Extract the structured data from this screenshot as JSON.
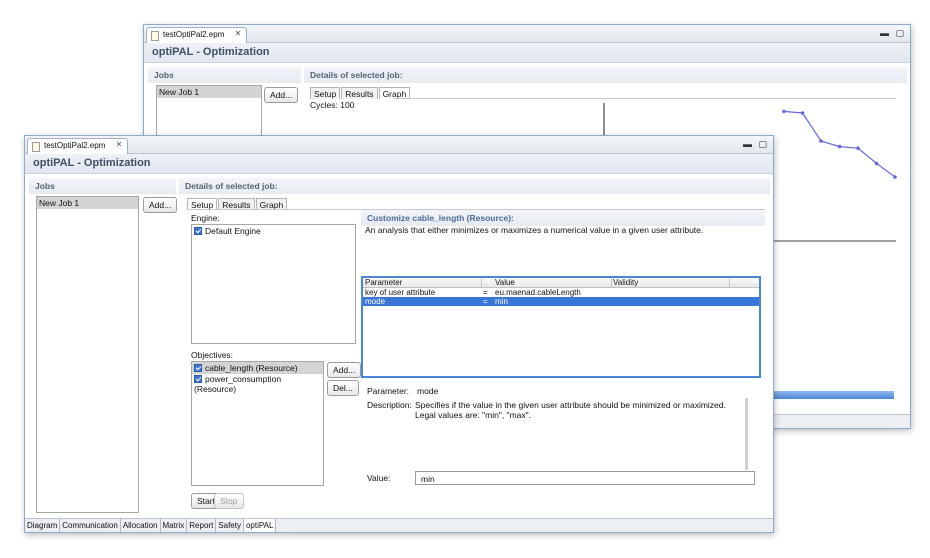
{
  "back_window": {
    "tab_title": "testOptiPal2.epm",
    "app_title": "optiPAL - Optimization",
    "jobs_header": "Jobs",
    "details_header": "Details of selected job:",
    "job_item": "New Job 1",
    "add_label": "Add...",
    "subtabs": [
      "Setup",
      "Results",
      "Graph"
    ],
    "cycles_text": "Cycles: 100",
    "graph_points": [
      [
        0,
        0.92
      ],
      [
        1,
        0.9
      ],
      [
        2,
        0.55
      ],
      [
        3,
        0.48
      ],
      [
        4,
        0.46
      ],
      [
        5,
        0.27
      ],
      [
        6,
        0.1
      ]
    ]
  },
  "front_window": {
    "tab_title": "testOptiPal2.epm",
    "app_title": "optiPAL - Optimization",
    "jobs_header": "Jobs",
    "details_header": "Details of selected job:",
    "job_item": "New Job 1",
    "add_label": "Add...",
    "subtabs": [
      "Setup",
      "Results",
      "Graph"
    ],
    "engine_label": "Engine:",
    "engine_item": "Default Engine",
    "objectives_label": "Objectives:",
    "objectives": [
      "cable_length (Resource)",
      "power_consumption (Resource)"
    ],
    "obj_add_label": "Add...",
    "obj_del_label": "Del...",
    "start_label": "Start",
    "stop_label": "Stop",
    "customize_header": "Customize cable_length (Resource):",
    "customize_desc": "An analysis that either minimizes or maximizes a numerical value in a given user attribute.",
    "table_headers": [
      "Parameter",
      "Value",
      "Validity"
    ],
    "table_rows": [
      {
        "param": "key of user attribute",
        "eq": "=",
        "value": "eu.maenad.cableLength"
      },
      {
        "param": "mode",
        "eq": "=",
        "value": "min"
      }
    ],
    "param_label": "Parameter:",
    "param_value": "mode",
    "desc_label": "Description:",
    "desc_value": "Specifies if the value in the given user attribute should be minimized or maximized. Legal values are: \"min\", \"max\".",
    "value_label": "Value:",
    "value_input": "min",
    "bottom_tabs": [
      "Diagram",
      "Communication",
      "Allocation",
      "Matrix",
      "Report",
      "Safety",
      "optiPAL"
    ],
    "active_bottom_tab": "optiPAL"
  },
  "colors": {
    "accent": "#3875d7",
    "header_text": "#3e4f66",
    "graph_line": "#6666dd"
  }
}
